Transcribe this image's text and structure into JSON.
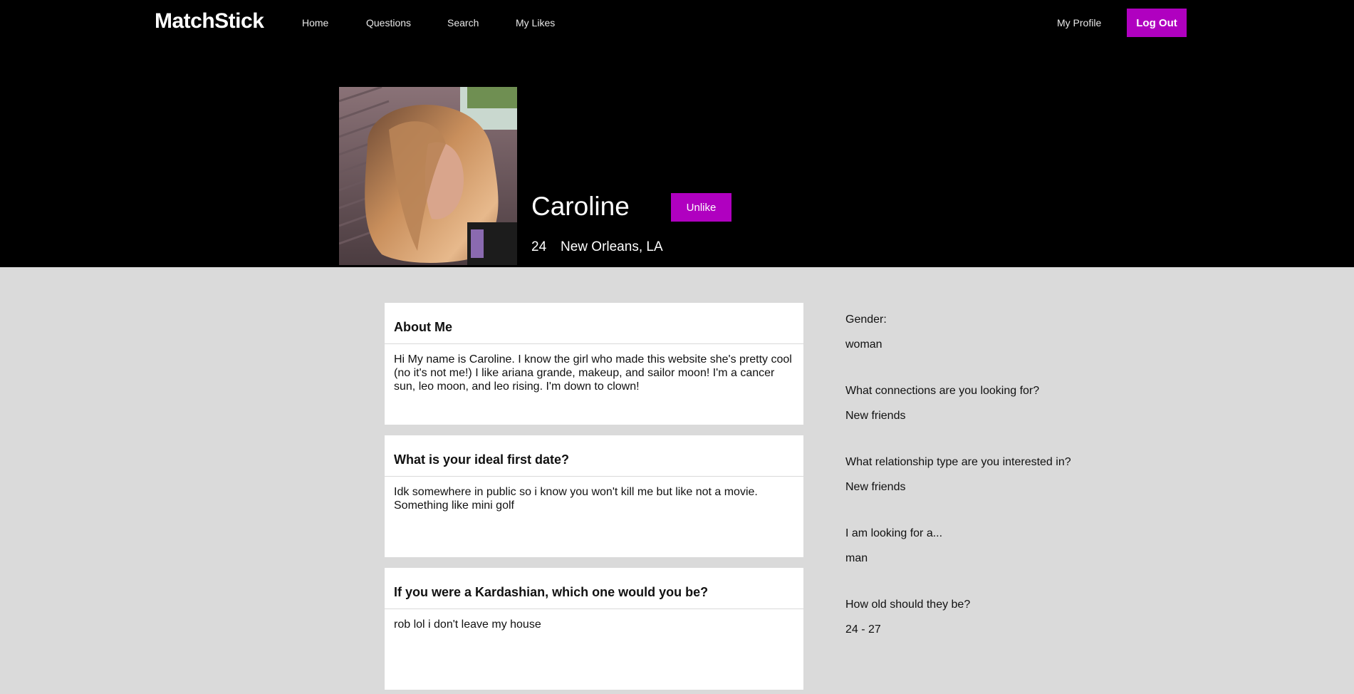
{
  "nav": {
    "brand": "MatchStick",
    "links": [
      "Home",
      "Questions",
      "Search",
      "My Likes"
    ],
    "my_profile": "My Profile",
    "logout": "Log Out"
  },
  "profile": {
    "name": "Caroline",
    "unlike_label": "Unlike",
    "age": "24",
    "location": "New Orleans, LA"
  },
  "cards": [
    {
      "title": "About Me",
      "body": "Hi My name is Caroline. I know the girl who made this website she's pretty cool (no it's not me!) I like ariana grande, makeup, and sailor moon! I'm a cancer sun, leo moon, and leo rising. I'm down to clown!"
    },
    {
      "title": "What is your ideal first date?",
      "body": "Idk somewhere in public so i know you won't kill me but like not a movie. Something like mini golf"
    },
    {
      "title": "If you were a Kardashian, which one would you be?",
      "body": "rob lol i don't leave my house"
    }
  ],
  "details": [
    {
      "label": "Gender:",
      "value": "woman"
    },
    {
      "label": "What connections are you looking for?",
      "value": "New friends"
    },
    {
      "label": "What relationship type are you interested in?",
      "value": "New friends"
    },
    {
      "label": "I am looking for a...",
      "value": "man"
    },
    {
      "label": "How old should they be?",
      "value": "24 - 27"
    }
  ],
  "colors": {
    "accent": "#b000c0",
    "hero_bg": "#000000",
    "page_bg": "#dadada"
  }
}
